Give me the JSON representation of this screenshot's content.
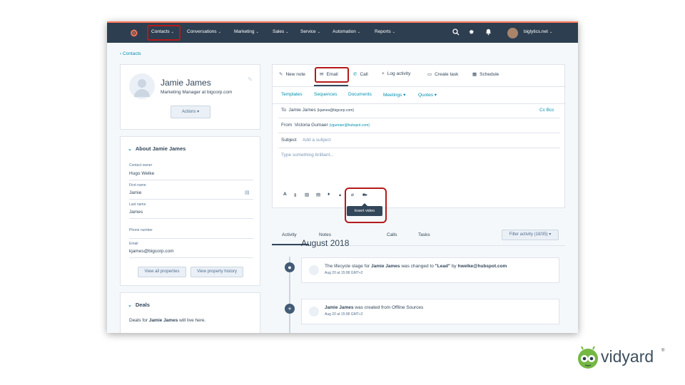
{
  "nav": {
    "items": [
      {
        "label": "Contacts"
      },
      {
        "label": "Conversations"
      },
      {
        "label": "Marketing"
      },
      {
        "label": "Sales"
      },
      {
        "label": "Service"
      },
      {
        "label": "Automation"
      },
      {
        "label": "Reports"
      }
    ],
    "account": "biglytics.net"
  },
  "breadcrumb": "‹ Contacts",
  "profile": {
    "name": "Jamie James",
    "title": "Marketing Manager at bigcorp.com",
    "actions_label": "Actions ▾"
  },
  "about": {
    "title": "About Jamie James",
    "fields": [
      {
        "label": "Contact owner",
        "value": "Hugo Welke"
      },
      {
        "label": "First name",
        "value": "Jamie"
      },
      {
        "label": "Last name",
        "value": "James"
      },
      {
        "label": "Phone number",
        "value": ""
      },
      {
        "label": "Email",
        "value": "kjames@bigcorp.com"
      }
    ],
    "view_all": "View all properties",
    "view_history": "View property history"
  },
  "deals": {
    "title": "Deals",
    "text_pre": "Deals for ",
    "text_name": "Jamie James",
    "text_post": " will live here."
  },
  "actions": {
    "new_note": "New note",
    "email": "Email",
    "call": "Call",
    "log_activity": "Log activity",
    "create_task": "Create task",
    "schedule": "Schedule"
  },
  "email_tabs": {
    "templates": "Templates",
    "sequences": "Sequences",
    "documents": "Documents",
    "meetings": "Meetings ▾",
    "quotes": "Quotes ▾"
  },
  "composer": {
    "to_label": "To",
    "to_name": "Jamie James",
    "to_email": "(kjames@bigcorp.com)",
    "cc_bcc": "Cc  Bcc",
    "from_label": "From",
    "from_name": "Victoria Gumaer",
    "from_email": "(vgumaer@hubspot.com)",
    "subject_label": "Subject",
    "subject_placeholder": "Add a subject",
    "body_placeholder": "Type something brilliant...",
    "tooltip": "Insert video"
  },
  "activity_tabs": {
    "activity": "Activity",
    "notes": "Notes",
    "calls": "Calls",
    "tasks": "Tasks"
  },
  "filter": "Filter activity (18/35) ▾",
  "month": "August 2018",
  "events": [
    {
      "pre": "The lifecycle stage for ",
      "name": "Jamie James",
      "mid": " was changed to ",
      "stage": "\"Lead\"",
      "by": " by ",
      "user": "hwelke@hubspot.com",
      "time": "Aug 20 at 15:08 GMT+2"
    },
    {
      "name": "Jamie James",
      "rest": " was created from Offline Sources",
      "time": "Aug 20 at 15:08 GMT+2"
    }
  ],
  "brand": {
    "name": "vidyard",
    "registered": "®"
  },
  "colors": {
    "nav_bg": "#2d3e50",
    "accent": "#ff7a59",
    "link": "#0091ae",
    "highlight": "#b31b1b",
    "vidyard_green": "#75b843"
  }
}
